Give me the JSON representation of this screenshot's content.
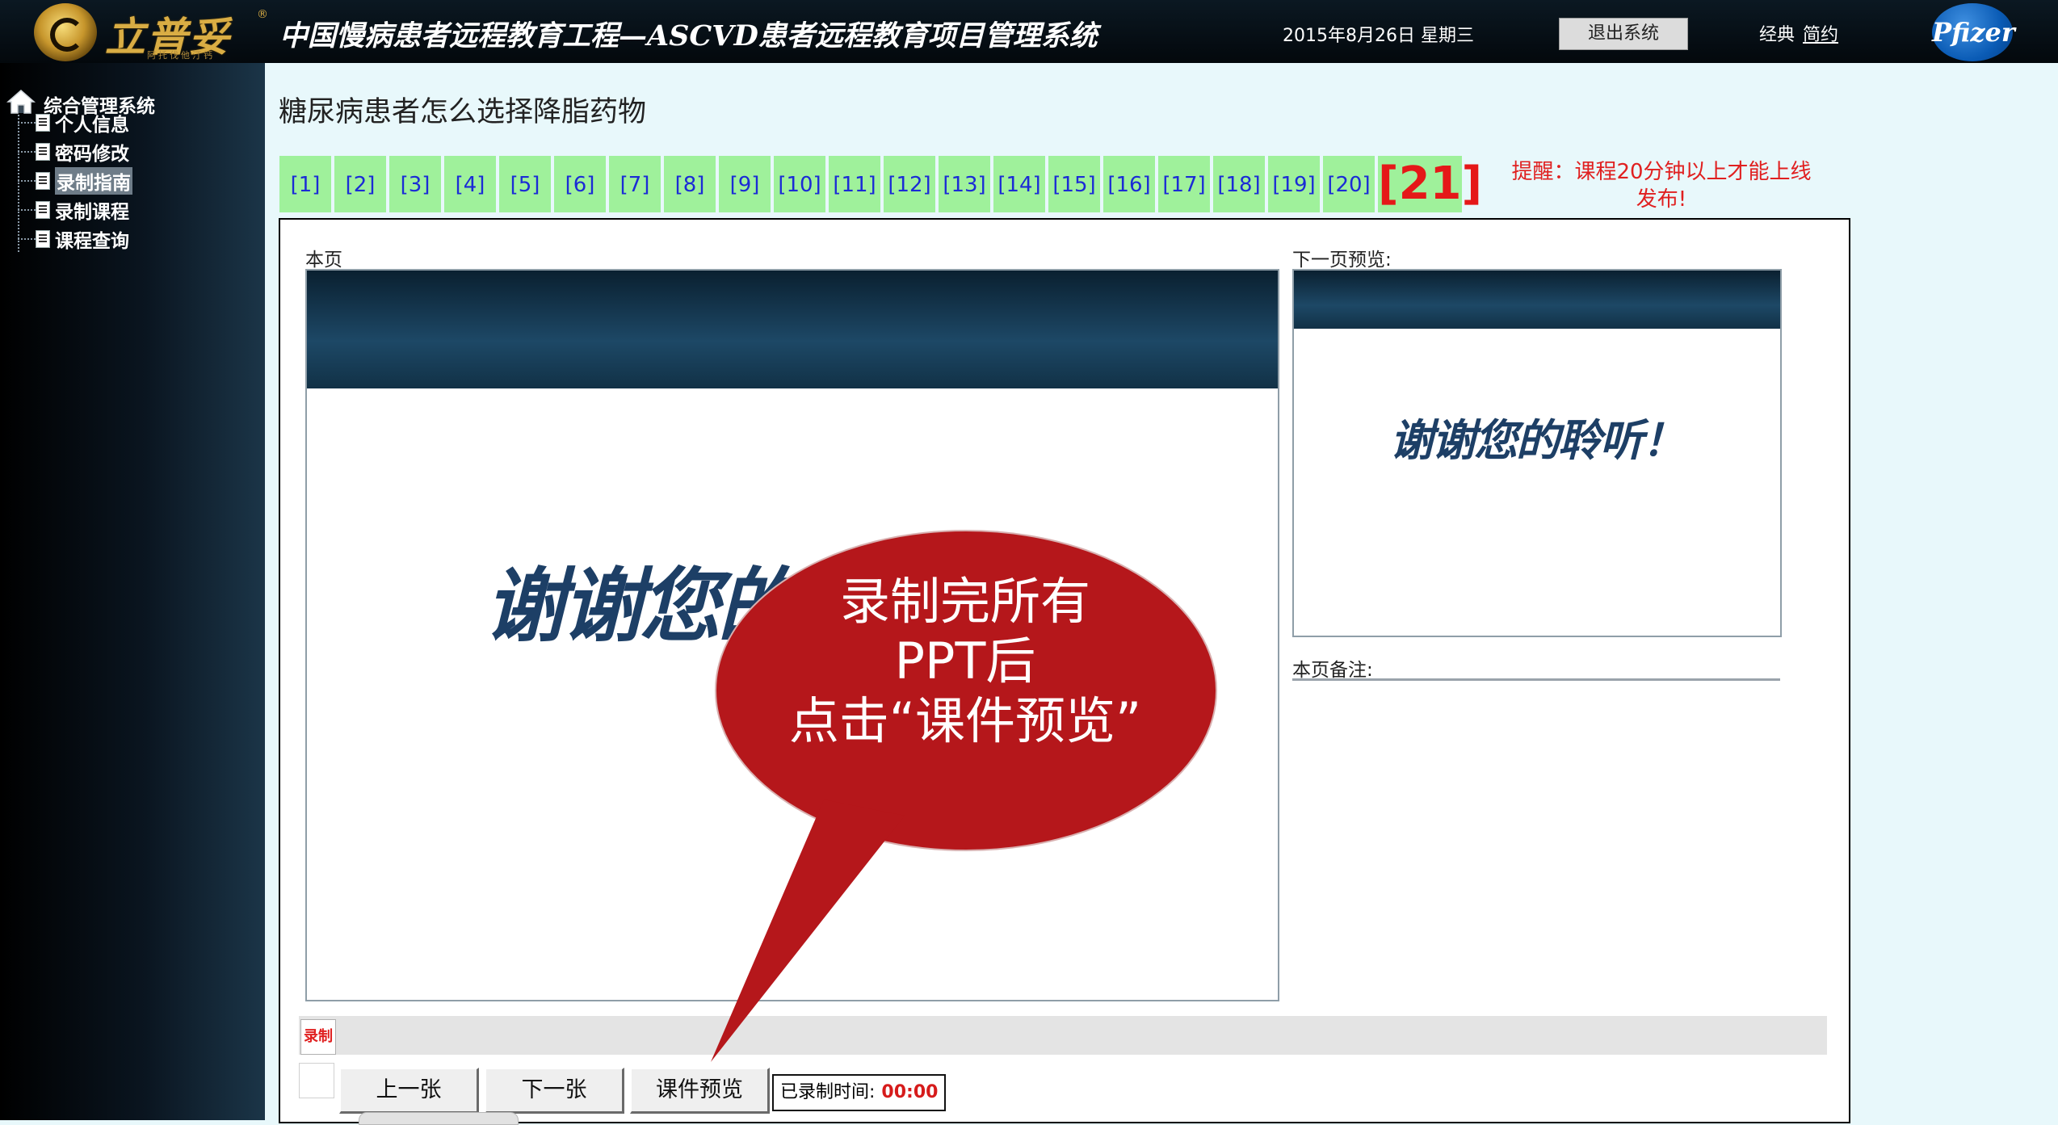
{
  "header": {
    "logo_text": "立普妥",
    "logo_sub": "阿托伐他汀钙",
    "logo_reg": "®",
    "title": "中国慢病患者远程教育工程—ASCVD患者远程教育项目管理系统",
    "date": "2015年8月26日  星期三",
    "logout_label": "退出系统",
    "style_classic": "经典",
    "style_simple": "简约",
    "pfizer_logo": "Pfizer"
  },
  "sidebar": {
    "root_label": "综合管理系统",
    "items": [
      {
        "label": "个人信息"
      },
      {
        "label": "密码修改"
      },
      {
        "label": "录制指南"
      },
      {
        "label": "录制课程"
      },
      {
        "label": "课程查询"
      }
    ],
    "active_index": 2
  },
  "main": {
    "course_title": "糖尿病患者怎么选择降脂药物",
    "pages": [
      "[1]",
      "[2]",
      "[3]",
      "[4]",
      "[5]",
      "[6]",
      "[7]",
      "[8]",
      "[9]",
      "[10]",
      "[11]",
      "[12]",
      "[13]",
      "[14]",
      "[15]",
      "[16]",
      "[17]",
      "[18]",
      "[19]",
      "[20]",
      "[21]"
    ],
    "current_page": "[21]",
    "reminder": "提醒：课程20分钟以上才能上线发布!",
    "current_label": "本页",
    "next_label": "下一页预览:",
    "notes_label": "本页备注:",
    "slide_current_text": "谢谢您的聆听！",
    "slide_next_text": "谢谢您的聆听！",
    "record_icon_label": "录制",
    "prev_label": "上一张",
    "next_btn_label": "下一张",
    "preview_label": "课件预览",
    "rec_time_label": "已录制时间:",
    "rec_time_value": "00:00"
  },
  "callout": {
    "lines": [
      "录制完所有",
      "PPT后",
      "点击“课件预览”"
    ],
    "color": "#b5171b"
  },
  "colors": {
    "page_button_bg": "#9ff19b",
    "page_button_text": "#1b2bd6",
    "current_page_text": "#e51818",
    "reminder_text": "#e02020",
    "main_bg": "#e8f8fb"
  }
}
